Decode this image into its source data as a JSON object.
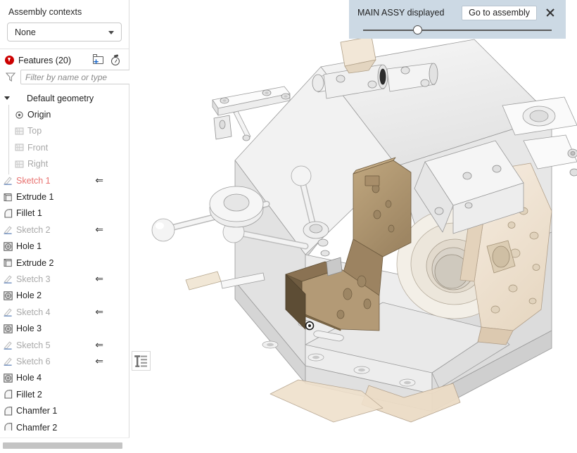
{
  "sidebar": {
    "context_section": {
      "title": "Assembly contexts",
      "selected": "None",
      "caret_icon": "chevron-down-icon"
    },
    "features_header": {
      "title": "Features (20)",
      "error_icon": "error-rollback-icon",
      "new_folder_icon": "new-folder-icon",
      "history_icon": "stopwatch-icon"
    },
    "filter": {
      "icon": "funnel-icon",
      "placeholder": "Filter by name or type",
      "value": ""
    },
    "tree": [
      {
        "label": "Default geometry",
        "icon": "chevron-down-icon",
        "state": "normal",
        "level": 0,
        "expandable": true,
        "rollback": false
      },
      {
        "label": "Origin",
        "icon": "origin-icon",
        "state": "normal",
        "level": 1,
        "expandable": false,
        "rollback": false
      },
      {
        "label": "Top",
        "icon": "plane-icon",
        "state": "dim",
        "level": 1,
        "expandable": false,
        "rollback": false
      },
      {
        "label": "Front",
        "icon": "plane-icon",
        "state": "dim",
        "level": 1,
        "expandable": false,
        "rollback": false
      },
      {
        "label": "Right",
        "icon": "plane-icon",
        "state": "dim",
        "level": 1,
        "expandable": false,
        "rollback": false
      },
      {
        "label": "Sketch 1",
        "icon": "sketch-icon",
        "state": "error",
        "level": 0,
        "expandable": false,
        "rollback": true
      },
      {
        "label": "Extrude 1",
        "icon": "extrude-icon",
        "state": "normal",
        "level": 0,
        "expandable": false,
        "rollback": false
      },
      {
        "label": "Fillet 1",
        "icon": "fillet-icon",
        "state": "normal",
        "level": 0,
        "expandable": false,
        "rollback": false
      },
      {
        "label": "Sketch 2",
        "icon": "sketch-icon",
        "state": "dim",
        "level": 0,
        "expandable": false,
        "rollback": true
      },
      {
        "label": "Hole 1",
        "icon": "hole-icon",
        "state": "normal",
        "level": 0,
        "expandable": false,
        "rollback": false
      },
      {
        "label": "Extrude 2",
        "icon": "extrude-icon",
        "state": "normal",
        "level": 0,
        "expandable": false,
        "rollback": false
      },
      {
        "label": "Sketch 3",
        "icon": "sketch-icon",
        "state": "dim",
        "level": 0,
        "expandable": false,
        "rollback": true
      },
      {
        "label": "Hole 2",
        "icon": "hole-icon",
        "state": "normal",
        "level": 0,
        "expandable": false,
        "rollback": false
      },
      {
        "label": "Sketch 4",
        "icon": "sketch-icon",
        "state": "dim",
        "level": 0,
        "expandable": false,
        "rollback": true
      },
      {
        "label": "Hole 3",
        "icon": "hole-icon",
        "state": "normal",
        "level": 0,
        "expandable": false,
        "rollback": false
      },
      {
        "label": "Sketch 5",
        "icon": "sketch-icon",
        "state": "dim",
        "level": 0,
        "expandable": false,
        "rollback": true
      },
      {
        "label": "Sketch 6",
        "icon": "sketch-icon",
        "state": "dim",
        "level": 0,
        "expandable": false,
        "rollback": true
      },
      {
        "label": "Hole 4",
        "icon": "hole-icon",
        "state": "normal",
        "level": 0,
        "expandable": false,
        "rollback": false
      },
      {
        "label": "Fillet 2",
        "icon": "fillet-icon",
        "state": "normal",
        "level": 0,
        "expandable": false,
        "rollback": false
      },
      {
        "label": "Chamfer 1",
        "icon": "fillet-icon",
        "state": "normal",
        "level": 0,
        "expandable": false,
        "rollback": false
      },
      {
        "label": "Chamfer 2",
        "icon": "fillet-icon",
        "state": "normal",
        "level": 0,
        "expandable": false,
        "rollback": false
      }
    ],
    "rollback_arrow_glyph": "⇐",
    "horizontal_scrollbar": "h-scrollbar"
  },
  "banner": {
    "label": "MAIN ASSY displayed",
    "button_label": "Go to assembly",
    "close_icon": "close-icon",
    "slider": {
      "value_percent": 29,
      "name": "transparency-slider"
    },
    "background_color": "#ccd9e4"
  },
  "viewport": {
    "tree_toggle_icon": "feature-list-icon",
    "background_color": "#ffffff",
    "model_colors": {
      "body_light": "#ececec",
      "body_shadow": "#d8d8d8",
      "highlight_tan": "#b49a78",
      "highlight_tan_dark": "#8b7352",
      "cream": "#f0e4d4",
      "edge": "#8c8c8c"
    }
  }
}
